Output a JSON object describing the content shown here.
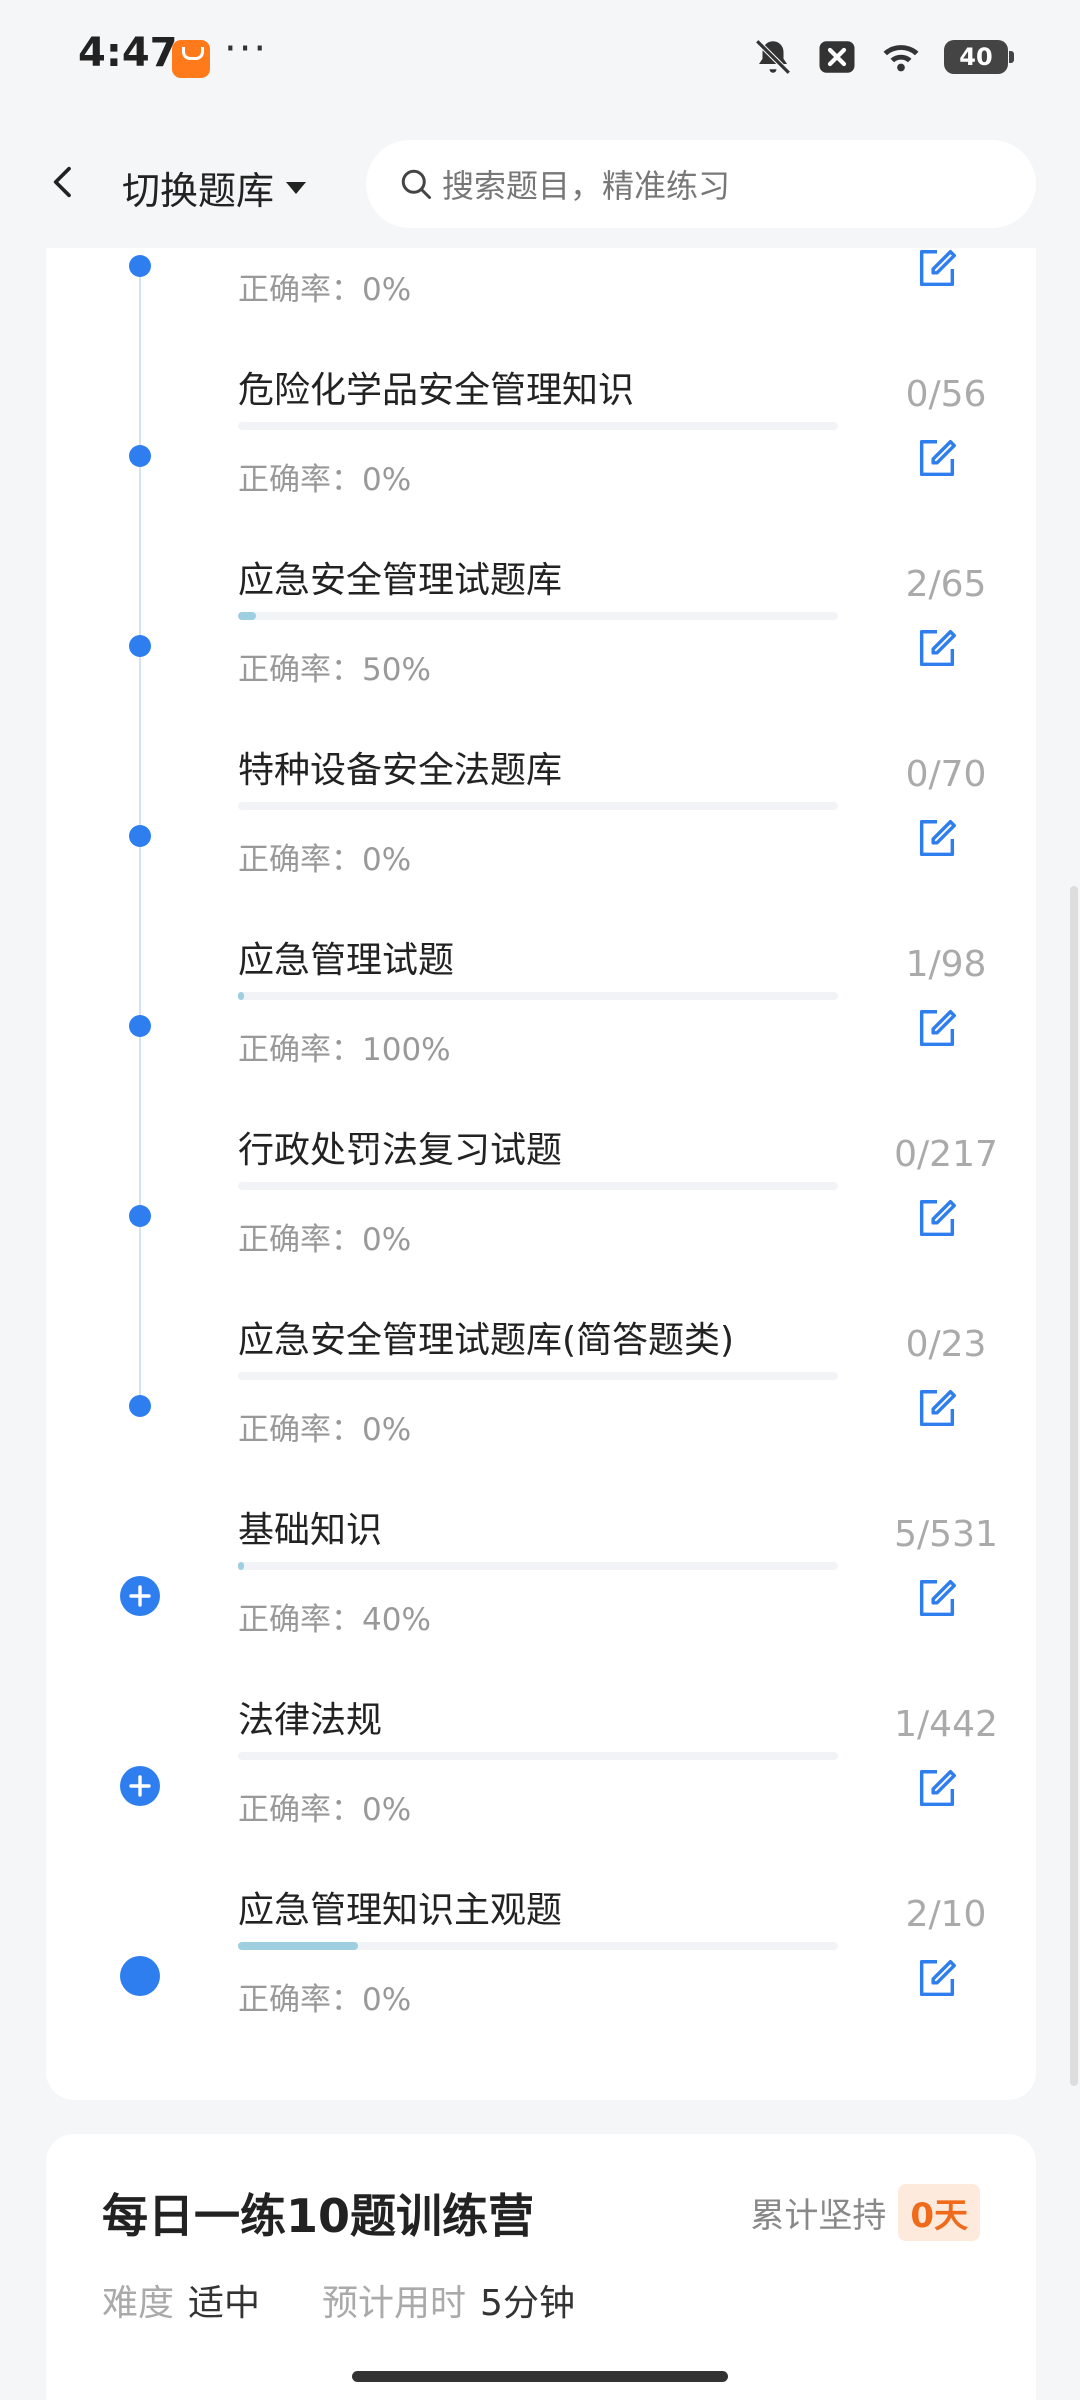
{
  "status": {
    "time": "4:47",
    "battery": "40"
  },
  "header": {
    "switch_label": "切换题库",
    "search_placeholder": "搜索题目，精准练习"
  },
  "items": [
    {
      "title": "",
      "count": "",
      "accuracy": "正确率：0%",
      "progress": 0.01,
      "marker": "dot"
    },
    {
      "title": "危险化学品安全管理知识",
      "count": "0/56",
      "accuracy": "正确率：0%",
      "progress": 0,
      "marker": "dot"
    },
    {
      "title": "应急安全管理试题库",
      "count": "2/65",
      "accuracy": "正确率：50%",
      "progress": 0.03,
      "marker": "dot"
    },
    {
      "title": "特种设备安全法题库",
      "count": "0/70",
      "accuracy": "正确率：0%",
      "progress": 0,
      "marker": "dot"
    },
    {
      "title": "应急管理试题",
      "count": "1/98",
      "accuracy": "正确率：100%",
      "progress": 0.01,
      "marker": "dot"
    },
    {
      "title": "行政处罚法复习试题",
      "count": "0/217",
      "accuracy": "正确率：0%",
      "progress": 0,
      "marker": "dot"
    },
    {
      "title": "应急安全管理试题库(简答题类)",
      "count": "0/23",
      "accuracy": "正确率：0%",
      "progress": 0,
      "marker": "dot"
    },
    {
      "title": "基础知识",
      "count": "5/531",
      "accuracy": "正确率：40%",
      "progress": 0.01,
      "marker": "plus"
    },
    {
      "title": "法律法规",
      "count": "1/442",
      "accuracy": "正确率：0%",
      "progress": 0,
      "marker": "plus"
    },
    {
      "title": "应急管理知识主观题",
      "count": "2/10",
      "accuracy": "正确率：0%",
      "progress": 0.2,
      "marker": "big-dot"
    }
  ],
  "daily": {
    "title": "每日一练10题训练营",
    "persist_label": "累计坚持",
    "persist_days": "0天",
    "difficulty_label": "难度",
    "difficulty_value": "适中",
    "time_label": "预计用时",
    "time_value": "5分钟"
  },
  "colors": {
    "accent": "#2f7ef0",
    "progress": "#9ecfe0",
    "streak": "#f06a1c"
  }
}
